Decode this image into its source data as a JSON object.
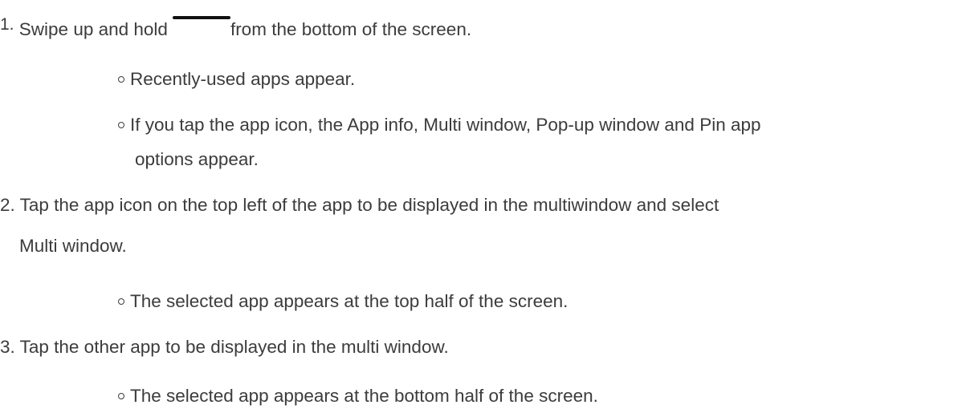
{
  "steps": [
    {
      "number": "1.",
      "text_before": "Swipe up and hold",
      "icon": "navigation-bar-icon",
      "text_after": "from the bottom of the screen.",
      "subitems": [
        "Recently-used apps appear.",
        "If you tap the app icon, the App info, Multi window, Pop-up window and Pin app",
        "options appear."
      ]
    },
    {
      "number": "2.",
      "line1": "Tap the app icon on the top left of the app to be displayed in the multiwindow and select",
      "line2": "Multi window.",
      "subitems": [
        "The selected app appears at the top half of the screen."
      ]
    },
    {
      "number": "3.",
      "text": "Tap the other app to be displayed in the multi window.",
      "subitems": [
        "The selected app appears at the bottom half of the screen."
      ]
    }
  ]
}
